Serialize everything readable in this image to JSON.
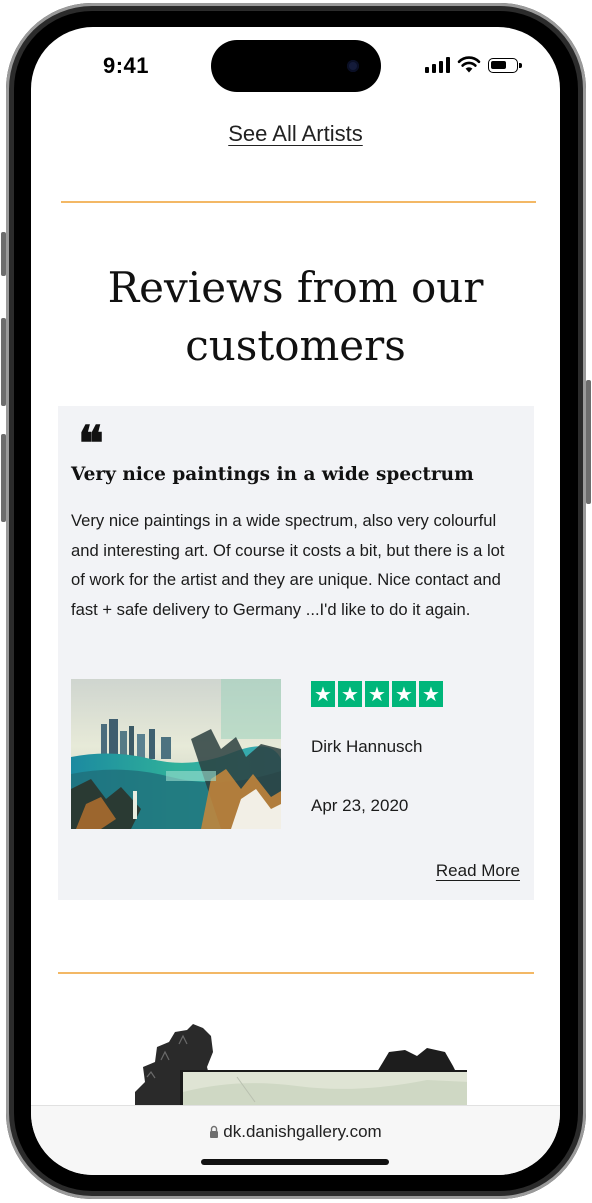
{
  "status_bar": {
    "time": "9:41",
    "battery_level": 0.7
  },
  "see_all_artists": "See All Artists",
  "reviews": {
    "heading_line1": "Reviews from our",
    "heading_line2": "customers"
  },
  "review_card": {
    "quote_glyph": "❝",
    "title": "Very nice paintings in a wide spectrum",
    "body": "Very nice paintings in a wide spectrum, also very colourful and interesting art. Of course it costs a bit, but there is a lot of work for the artist and they are unique. Nice contact and fast + safe delivery to Germany ...I'd like to do it again.",
    "rating": 5,
    "star_glyph": "★",
    "star_color": "#00b67a",
    "reviewer": "Dirk Hannusch",
    "date": "Apr 23, 2020",
    "read_more": "Read More"
  },
  "accent_color": "#f3b865",
  "browser": {
    "url": "dk.danishgallery.com"
  }
}
